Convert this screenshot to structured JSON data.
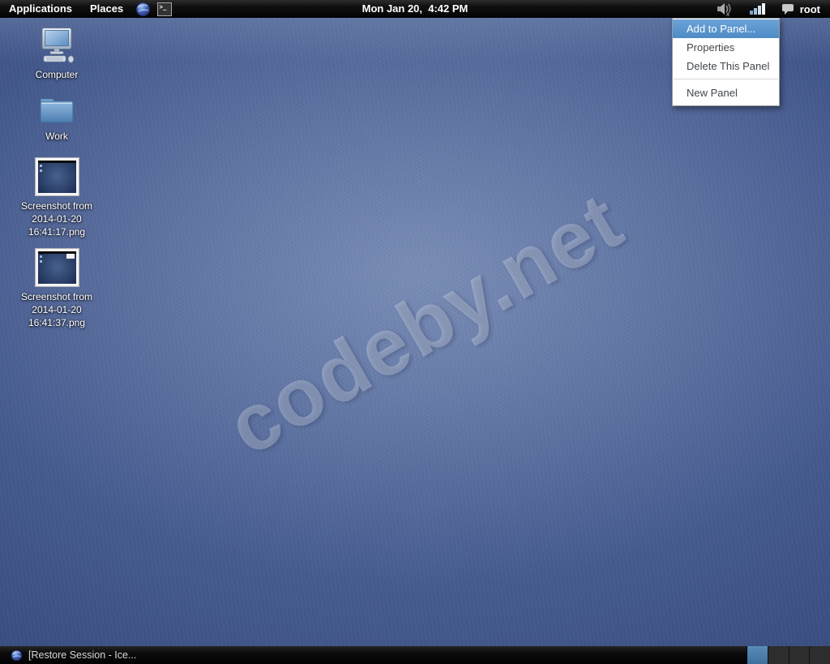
{
  "top_panel": {
    "menus": [
      {
        "label": "Applications"
      },
      {
        "label": "Places"
      }
    ],
    "clock": "Mon Jan 20,  4:42 PM",
    "user_label": "root"
  },
  "context_menu": {
    "items": [
      {
        "label": "Add to Panel...",
        "highlighted": true
      },
      {
        "label": "Properties",
        "highlighted": false
      },
      {
        "label": "Delete This Panel",
        "highlighted": false
      },
      {
        "label": "New Panel",
        "highlighted": false
      }
    ]
  },
  "desktop": {
    "watermark": "codeby.net",
    "icons": [
      {
        "label": "Computer",
        "icon": "computer-icon"
      },
      {
        "label": "Work",
        "icon": "folder-icon"
      },
      {
        "label": "Screenshot from 2014-01-20 16:41:17.png",
        "icon": "image-thumbnail-icon"
      },
      {
        "label": "Screenshot from 2014-01-20 16:41:37.png",
        "icon": "image-thumbnail-icon"
      }
    ]
  },
  "bottom_panel": {
    "task_label": "[Restore Session - Ice...",
    "workspaces": {
      "count": 4,
      "active_index": 0
    }
  },
  "icons": {
    "status_volume": "volume-muted-icon",
    "status_network": "network-signal-icon",
    "user_badge": "chat-bubble-icon",
    "launcher_browser": "browser-globe-icon",
    "launcher_terminal": "terminal-icon",
    "task_icon": "browser-globe-icon"
  },
  "colors": {
    "menu_highlight": "#5e97ce",
    "panel_bg": "#0a0a0a",
    "wallpaper_center": "#5f78a8",
    "wallpaper_edge": "#1b2a55",
    "workspace_active": "#4a7dab"
  }
}
